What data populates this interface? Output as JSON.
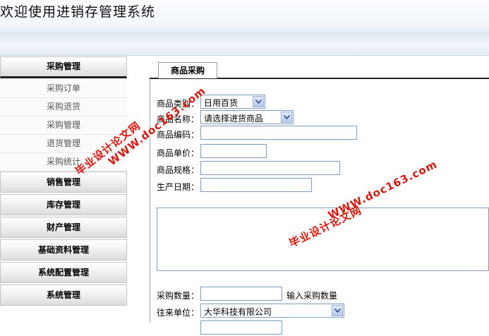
{
  "header": {
    "title": "欢迎使用进销存管理系统"
  },
  "sidebar": {
    "active_group": "采购管理",
    "sub_items": [
      "采购订单",
      "采购退货",
      "采购管理",
      "退货管理",
      "采购统计"
    ],
    "groups": [
      "销售管理",
      "库存管理",
      "财产管理",
      "基础资料管理",
      "系统配置管理",
      "系统管理"
    ]
  },
  "main": {
    "tab_label": "商品采购",
    "form": {
      "category_label": "商品类别：",
      "category_value": "日用百货",
      "name_label": "商品名称：",
      "name_value": "请选择进货商品",
      "code_label": "商品编码：",
      "price_label": "商品单价：",
      "spec_label": "商品规格：",
      "date_label": "生产日期：",
      "quantity_label": "采购数量：",
      "quantity_hint": "输入采购数量",
      "partner_label": "往来单位：",
      "partner_value": "大华科技有限公司"
    }
  },
  "watermarks": {
    "site": "WWW.doc163.com",
    "text": "毕业设计论文网"
  }
}
